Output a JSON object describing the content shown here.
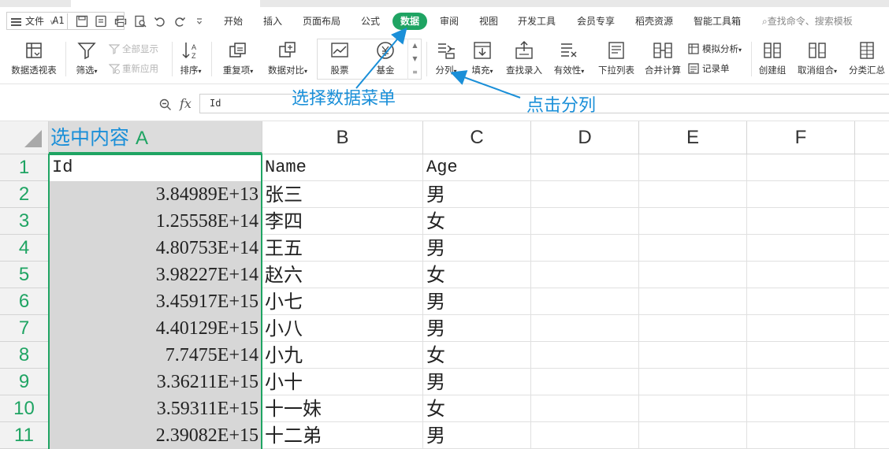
{
  "menu": {
    "file_label": "文件",
    "tabs": [
      "开始",
      "插入",
      "页面布局",
      "公式",
      "数据",
      "审阅",
      "视图",
      "开发工具",
      "会员专享",
      "稻壳资源",
      "智能工具箱"
    ],
    "active_tab": "数据",
    "search_placeholder": "查找命令、搜索模板"
  },
  "ribbon": {
    "pivot": "数据透视表",
    "filter": "筛选",
    "show_all": "全部显示",
    "reapply": "重新应用",
    "sort": "排序",
    "duplicates": "重复项",
    "compare": "数据对比",
    "stocks": "股票",
    "funds": "基金",
    "split": "分列",
    "fill": "填充",
    "lookup": "查找录入",
    "validity": "有效性",
    "dropdown": "下拉列表",
    "consolidate": "合并计算",
    "whatif": "模拟分析",
    "record": "记录单",
    "group": "创建组",
    "ungroup": "取消组合",
    "subtotal": "分类汇总"
  },
  "formula_bar": {
    "cell_ref": "A1",
    "fx": "fx",
    "value": "Id"
  },
  "sheet": {
    "columns": [
      "A",
      "B",
      "C",
      "D",
      "E",
      "F"
    ],
    "selected_column_note": "选中内容",
    "rows": [
      {
        "num": "1",
        "a": "Id",
        "b": "Name",
        "c": "Age"
      },
      {
        "num": "2",
        "a": "3.84989E+13",
        "b": "张三",
        "c": "男"
      },
      {
        "num": "3",
        "a": "1.25558E+14",
        "b": "李四",
        "c": "女"
      },
      {
        "num": "4",
        "a": "4.80753E+14",
        "b": "王五",
        "c": "男"
      },
      {
        "num": "5",
        "a": "3.98227E+14",
        "b": "赵六",
        "c": "女"
      },
      {
        "num": "6",
        "a": "3.45917E+15",
        "b": "小七",
        "c": "男"
      },
      {
        "num": "7",
        "a": "4.40129E+15",
        "b": "小八",
        "c": "男"
      },
      {
        "num": "8",
        "a": "7.7475E+14",
        "b": "小九",
        "c": "女"
      },
      {
        "num": "9",
        "a": "3.36211E+15",
        "b": "小十",
        "c": "男"
      },
      {
        "num": "10",
        "a": "3.59311E+15",
        "b": "十一妹",
        "c": "女"
      },
      {
        "num": "11",
        "a": "2.39082E+15",
        "b": "十二弟",
        "c": "男"
      }
    ]
  },
  "annotations": {
    "select_data_menu": "选择数据菜单",
    "click_split": "点击分列"
  },
  "colors": {
    "accent_green": "#1fa463",
    "annotation_blue": "#1a8fd8"
  }
}
